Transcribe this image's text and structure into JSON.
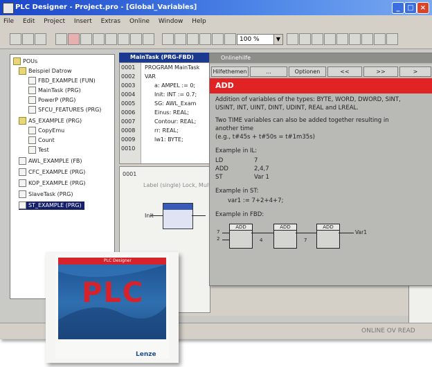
{
  "window": {
    "title": "PLC Designer - Project.pro - [Global_Variables]",
    "controls": [
      "_",
      "□",
      "×"
    ]
  },
  "menu": [
    "File",
    "Edit",
    "Project",
    "Insert",
    "Extras",
    "Online",
    "Window",
    "Help"
  ],
  "toolbar": {
    "zoom_value": "100 %"
  },
  "tree": {
    "root": "POUs",
    "items": [
      {
        "label": "Beispiel Datrow",
        "level": 1,
        "type": "folder"
      },
      {
        "label": "FBD_EXAMPLE (FUN)",
        "level": 2,
        "type": "pou"
      },
      {
        "label": "MainTask (PRG)",
        "level": 2,
        "type": "pou"
      },
      {
        "label": "PowerP (PRG)",
        "level": 2,
        "type": "pou"
      },
      {
        "label": "SFCU_FEATURES (PRG)",
        "level": 2,
        "type": "pou"
      },
      {
        "label": "AS_EXAMPLE (PRG)",
        "level": 1,
        "type": "folder"
      },
      {
        "label": "CopyEmu",
        "level": 2,
        "type": "pou"
      },
      {
        "label": "Count",
        "level": 2,
        "type": "pou"
      },
      {
        "label": "Test",
        "level": 2,
        "type": "pou"
      },
      {
        "label": "AWL_EXAMPLE (FB)",
        "level": 1,
        "type": "pou"
      },
      {
        "label": "CFC_EXAMPLE (PRG)",
        "level": 1,
        "type": "pou"
      },
      {
        "label": "KOP_EXAMPLE (PRG)",
        "level": 1,
        "type": "pou"
      },
      {
        "label": "SlaveTask (PRG)",
        "level": 1,
        "type": "pou"
      },
      {
        "label": "ST_EXAMPLE (PRG)",
        "level": 1,
        "type": "pou",
        "selected": true
      }
    ]
  },
  "editor": {
    "title": "MainTask (PRG-FBD)",
    "line_numbers": [
      "0001",
      "0002",
      "0003",
      "0004",
      "0005",
      "0006",
      "0007",
      "0008",
      "0009",
      "0010"
    ],
    "lines": [
      "PROGRAM MainTask",
      "VAR",
      "a: AMPEL := 0;",
      "Init: INT := 0.7;",
      "SG: AWL_Exam",
      "Einus: REAL;",
      "Contour: REAL;",
      "rr: REAL;",
      "lw1: BYTE;",
      ""
    ],
    "network_number": "0001",
    "network_comment": "Label (single) Lock, Multiple",
    "fbd_label": "Init"
  },
  "help": {
    "title": "Onlinehilfe",
    "tabs": [
      "Hilfethemen",
      "...",
      "Optionen",
      "<<",
      ">>",
      ">"
    ],
    "heading": "ADD",
    "text": [
      "Addition of variables of the types: BYTE, WORD, DWORD, SINT,",
      "USINT, INT, UINT, DINT, UDINT, REAL and LREAL.",
      "Two TIME variables can also be added together resulting in",
      "another time",
      "(e.g., t#45s + t#50s = t#1m35s)",
      "Example in IL:",
      "Example in ST:",
      "var1 := 7+2+4+7;",
      "Example in FBD:"
    ],
    "il_rows": [
      {
        "op": "LD",
        "arg": "7"
      },
      {
        "op": "ADD",
        "arg": "2,4,7"
      },
      {
        "op": "ST",
        "arg": "Var 1"
      }
    ],
    "fbd": {
      "inputs": [
        "7",
        "2",
        "4",
        "7"
      ],
      "blocks": [
        "ADD",
        "ADD",
        "ADD"
      ],
      "output": "Var1"
    }
  },
  "status": {
    "text": "ONLINE OV READ"
  },
  "product_box": {
    "label": "PLC Designer",
    "title": "PLC",
    "brand": "Lenze"
  },
  "colors": {
    "title_blue": "#1b45c8",
    "help_red": "#e22323",
    "selection_navy": "#16206a",
    "box_blue": "#2f6fb0",
    "plc_red": "#d6232b"
  }
}
